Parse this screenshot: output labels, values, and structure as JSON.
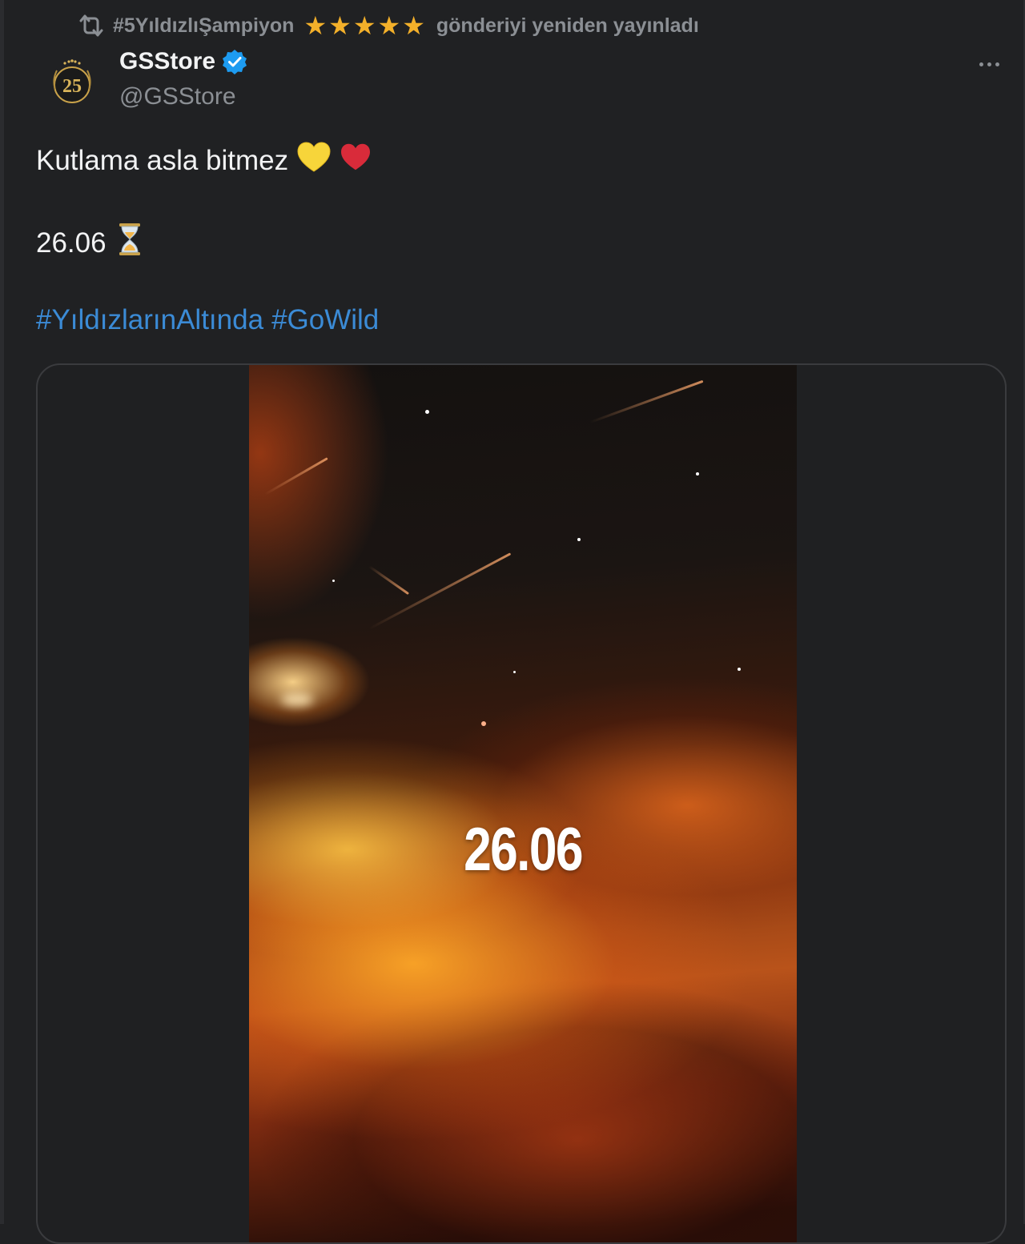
{
  "retweet": {
    "user": "#5YıldızlıŞampiyon",
    "stars": [
      "★",
      "★",
      "★",
      "★",
      "★"
    ],
    "suffix": "gönderiyi yeniden yayınladı",
    "icon": "retweet-icon"
  },
  "author": {
    "avatar_text": "25",
    "name": "GSStore",
    "handle": "@GSStore",
    "verified_icon": "verified-badge-icon"
  },
  "menu": {
    "icon": "more-options-icon"
  },
  "tweet": {
    "line1_text": "Kutlama asla bitmez",
    "line1_emojis": [
      "💛",
      "❤"
    ],
    "line2_text": "26.06",
    "line2_emoji": "⏳",
    "hashtags": [
      "#YıldızlarınAltında",
      "#GoWild"
    ]
  },
  "media": {
    "overlay_text": "26.06"
  },
  "colors": {
    "background": "#202123",
    "hashtag": "#3b8bd6",
    "secondary_text": "#8b8f94",
    "star": "#f3b02a",
    "verified": "#1d9bf0"
  }
}
